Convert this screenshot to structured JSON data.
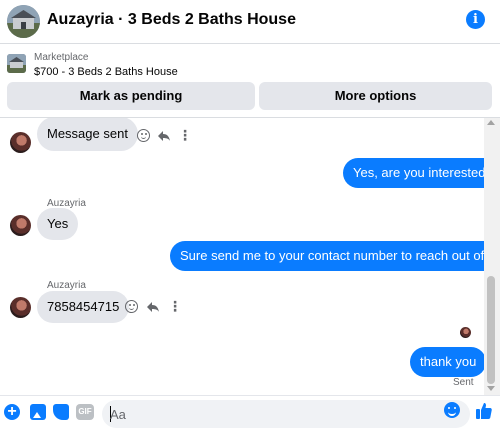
{
  "header": {
    "title": "Auzayria · 3 Beds 2 Baths House",
    "info_icon": "info-icon",
    "accent": "#0a7cff"
  },
  "marketplace": {
    "label": "Marketplace",
    "listing": "$700 - 3 Beds 2 Baths House",
    "buttons": {
      "mark_pending": "Mark as pending",
      "more_options": "More options"
    }
  },
  "messages": [
    {
      "direction": "in",
      "sender": "",
      "text": "Message sent"
    },
    {
      "direction": "out",
      "text": "Yes, are you interested?"
    },
    {
      "direction": "in",
      "sender": "Auzayria",
      "text": "Yes"
    },
    {
      "direction": "out",
      "text": "Sure send me to your contact number to reach out of you"
    },
    {
      "direction": "in",
      "sender": "Auzayria",
      "text": "7858454715"
    },
    {
      "direction": "out",
      "text": "thank you",
      "status": "Sent"
    }
  ],
  "composer": {
    "placeholder": "Aa",
    "icons": [
      "plus-icon",
      "photo-icon",
      "sticker-icon",
      "gif-icon",
      "emoji-icon",
      "like-icon"
    ],
    "gif_label": "GIF"
  },
  "colors": {
    "outgoing_bubble": "#0a7cff",
    "incoming_bubble": "#e4e6eb",
    "secondary_text": "#65676b"
  }
}
